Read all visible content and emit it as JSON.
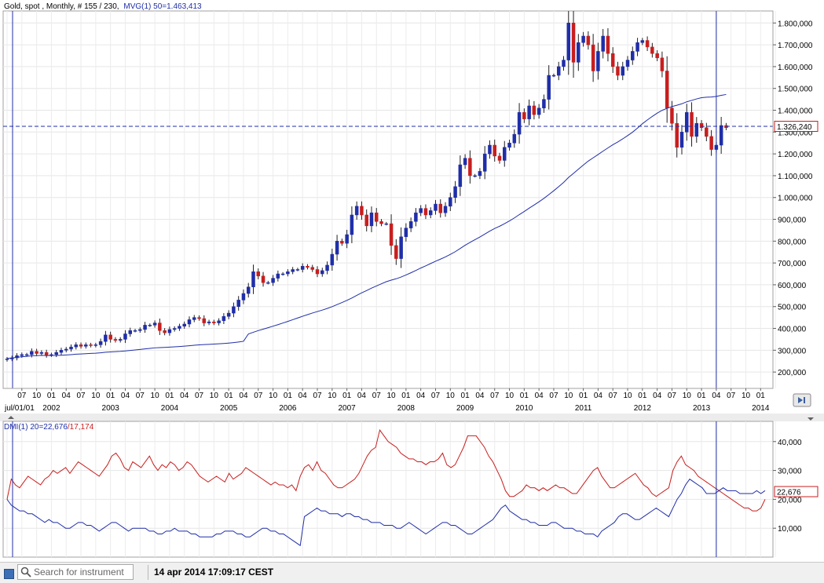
{
  "chart_data": [
    {
      "type": "candlestick",
      "header": "Gold, spot , Monthly, # 155 / 230,",
      "indicator_label": "MVG(1) 50=1.463,413",
      "indicator_color": "#1f2ea8",
      "up_color": "#1f2ea8",
      "down_color": "#c81e1e",
      "ylim": [
        125000,
        1855000
      ],
      "yticks": [
        "200,000",
        "300,000",
        "400,000",
        "500,000",
        "600,000",
        "700,000",
        "800,000",
        "900,000",
        "1.000,000",
        "1.100,000",
        "1.200,000",
        "1.300,000",
        "1.400,000",
        "1.500,000",
        "1.600,000",
        "1.700,000",
        "1.800,000"
      ],
      "ytick_values": [
        200000,
        300000,
        400000,
        500000,
        600000,
        700000,
        800000,
        900000,
        1000000,
        1100000,
        1200000,
        1300000,
        1400000,
        1500000,
        1600000,
        1700000,
        1800000
      ],
      "current_price_label": "1.326,240",
      "current_price": 1326240,
      "x_month_labels": [
        "07",
        "10",
        "01",
        "04",
        "07",
        "10",
        "01",
        "04",
        "07",
        "10",
        "01",
        "04",
        "07",
        "10",
        "01",
        "04",
        "07",
        "10",
        "01",
        "04",
        "07",
        "10",
        "01",
        "04",
        "07",
        "10",
        "01",
        "04",
        "07",
        "10",
        "01",
        "04",
        "07",
        "10",
        "01",
        "04",
        "07",
        "10",
        "01",
        "04",
        "07",
        "10",
        "01",
        "04",
        "07",
        "10",
        "01",
        "04",
        "07",
        "10",
        "01"
      ],
      "x_year_labels": [
        "jul/01/01",
        "2002",
        "2003",
        "2004",
        "2005",
        "2006",
        "2007",
        "2008",
        "2009",
        "2010",
        "2011",
        "2012",
        "2013",
        "2014"
      ],
      "start_month": "2001-04",
      "end_month": "2014-04",
      "cursor_line_month": "2013-04",
      "grid": true,
      "closes": [
        260,
        265,
        275,
        280,
        280,
        295,
        285,
        290,
        278,
        280,
        290,
        300,
        305,
        315,
        325,
        318,
        325,
        322,
        325,
        340,
        370,
        350,
        345,
        350,
        375,
        390,
        390,
        395,
        415,
        415,
        425,
        390,
        380,
        395,
        400,
        410,
        420,
        440,
        450,
        445,
        425,
        430,
        425,
        435,
        455,
        470,
        500,
        530,
        560,
        590,
        660,
        640,
        610,
        610,
        630,
        650,
        650,
        660,
        670,
        670,
        685,
        680,
        670,
        650,
        665,
        690,
        740,
        800,
        790,
        830,
        920,
        960,
        920,
        870,
        930,
        890,
        880,
        880,
        780,
        720,
        820,
        860,
        890,
        930,
        950,
        920,
        940,
        970,
        930,
        960,
        1000,
        1050,
        1150,
        1180,
        1100,
        1100,
        1120,
        1200,
        1240,
        1190,
        1170,
        1230,
        1250,
        1290,
        1390,
        1360,
        1420,
        1380,
        1410,
        1450,
        1560,
        1560,
        1600,
        1630,
        1800,
        1620,
        1710,
        1740,
        1700,
        1580,
        1670,
        1740,
        1660,
        1600,
        1560,
        1600,
        1630,
        1670,
        1710,
        1720,
        1690,
        1660,
        1640,
        1580,
        1410,
        1340,
        1230,
        1300,
        1390,
        1280,
        1340,
        1320,
        1280,
        1220,
        1240,
        1330,
        1320
      ],
      "ma_label": "MVG(1) 50"
    },
    {
      "type": "line",
      "indicator_label_prefix": "DMI(1) 20=",
      "value1_label": "22,676",
      "value2_label": "/17,174",
      "series_colors": [
        "#c81e1e",
        "#1f2ea8"
      ],
      "current_value_label": "22,676",
      "current_value": 22676,
      "ylim": [
        0,
        47000
      ],
      "yticks": [
        "10,000",
        "20,000",
        "30,000",
        "40,000"
      ],
      "ytick_values": [
        10000,
        20000,
        30000,
        40000
      ],
      "red_values": [
        20,
        27,
        25,
        24,
        26,
        28,
        27,
        26,
        25,
        27,
        28,
        30,
        29,
        30,
        31,
        29,
        31,
        33,
        32,
        31,
        30,
        29,
        28,
        30,
        32,
        35,
        36,
        34,
        31,
        30,
        33,
        32,
        31,
        33,
        35,
        32,
        30,
        32,
        31,
        33,
        32,
        30,
        31,
        33,
        32,
        30,
        28,
        27,
        26,
        27,
        28,
        27,
        26,
        29,
        27,
        28,
        29,
        31,
        30,
        29,
        28,
        27,
        26,
        25,
        26,
        25,
        25,
        24,
        25,
        23,
        28,
        31,
        32,
        30,
        33,
        30,
        29,
        27,
        25,
        24,
        24,
        25,
        26,
        27,
        29,
        32,
        35,
        37,
        38,
        44,
        42,
        40,
        39,
        38,
        36,
        35,
        34,
        34,
        33,
        33,
        32,
        33,
        33,
        34,
        36,
        32,
        31,
        32,
        35,
        38,
        42,
        42,
        42,
        40,
        38,
        35,
        33,
        30,
        27,
        23,
        21,
        21,
        22,
        23,
        25,
        24,
        24,
        23,
        24,
        23,
        24,
        25,
        24,
        24,
        23,
        22,
        22,
        24,
        26,
        28,
        30,
        31,
        28,
        26,
        24,
        24,
        25,
        26,
        27,
        28,
        29,
        27,
        25,
        24,
        22,
        21,
        22,
        23,
        24,
        30,
        33,
        35,
        32,
        31,
        30,
        28,
        27,
        26,
        25,
        24,
        23,
        22,
        21,
        20,
        19,
        18,
        17,
        17,
        16,
        16,
        17,
        20
      ],
      "blue_values": [
        20,
        18,
        17,
        16,
        16,
        15,
        15,
        14,
        13,
        12,
        13,
        12,
        12,
        11,
        10,
        10,
        11,
        12,
        12,
        11,
        11,
        10,
        9,
        10,
        11,
        12,
        12,
        11,
        10,
        9,
        10,
        10,
        10,
        10,
        9,
        9,
        8,
        8,
        9,
        9,
        10,
        9,
        9,
        9,
        8,
        8,
        7,
        7,
        7,
        7,
        8,
        8,
        9,
        9,
        9,
        8,
        8,
        7,
        7,
        8,
        9,
        10,
        10,
        9,
        9,
        8,
        8,
        7,
        6,
        5,
        4,
        14,
        15,
        16,
        17,
        16,
        16,
        15,
        15,
        15,
        14,
        15,
        15,
        14,
        14,
        13,
        13,
        12,
        12,
        12,
        11,
        11,
        11,
        10,
        10,
        11,
        12,
        11,
        10,
        9,
        8,
        9,
        10,
        11,
        12,
        12,
        11,
        11,
        10,
        9,
        8,
        8,
        9,
        10,
        11,
        12,
        13,
        15,
        17,
        18,
        16,
        15,
        14,
        13,
        13,
        12,
        12,
        11,
        11,
        11,
        12,
        12,
        11,
        10,
        10,
        10,
        9,
        9,
        8,
        8,
        8,
        7,
        9,
        10,
        11,
        12,
        14,
        15,
        15,
        14,
        13,
        13,
        14,
        15,
        16,
        17,
        16,
        15,
        14,
        17,
        20,
        22,
        25,
        27,
        26,
        25,
        24,
        22,
        22,
        22,
        23,
        24,
        23,
        23,
        23,
        22,
        22,
        22,
        22,
        23,
        22,
        23
      ]
    }
  ],
  "toolbar": {
    "search_placeholder": "Search for instrument",
    "datetime": "14 apr 2014 17:09:17 CEST"
  }
}
